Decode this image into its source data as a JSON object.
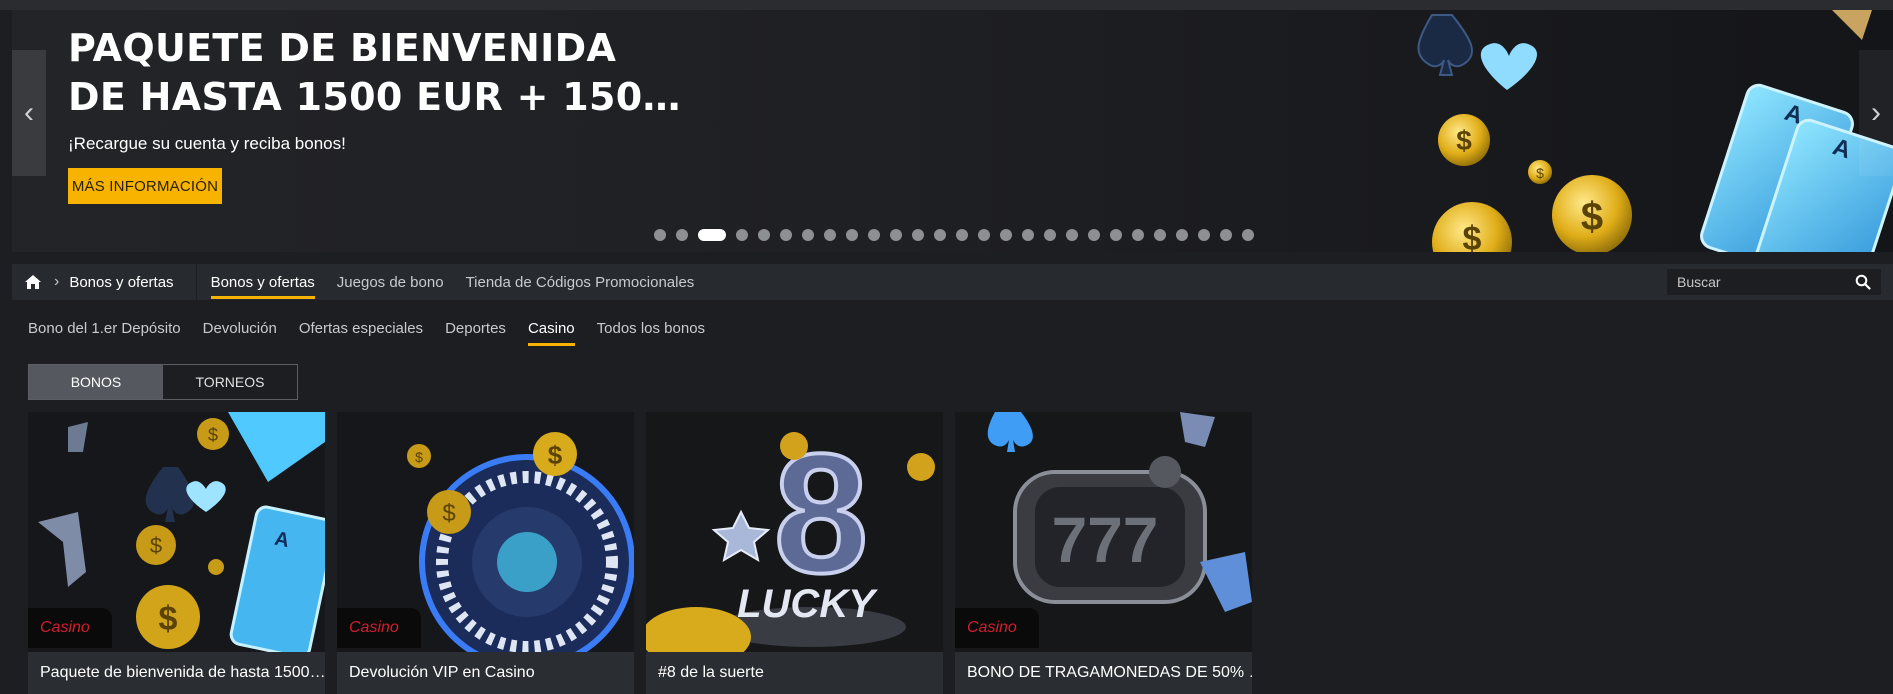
{
  "hero": {
    "title_line1": "PAQUETE DE BIENVENIDA",
    "title_line2": "DE HASTA 1500 EUR + 150…",
    "subtitle": "¡Recargue su cuenta y reciba bonos!",
    "button_label": "MÁS INFORMACIÓN",
    "prev_icon": "chevron-left-icon",
    "next_icon": "chevron-right-icon",
    "dots_count": 27,
    "active_dot_index": 2
  },
  "nav": {
    "home_icon": "home-icon",
    "breadcrumb_label": "Bonos y ofertas",
    "tabs": [
      {
        "label": "Bonos y ofertas"
      },
      {
        "label": "Juegos de bono"
      },
      {
        "label": "Tienda de Códigos Promocionales"
      }
    ],
    "search_placeholder": "Buscar",
    "search_icon": "search-icon"
  },
  "subtabs": [
    {
      "label": "Bono del 1.er Depósito"
    },
    {
      "label": "Devolución"
    },
    {
      "label": "Ofertas especiales"
    },
    {
      "label": "Deportes"
    },
    {
      "label": "Casino"
    },
    {
      "label": "Todos los bonos"
    }
  ],
  "active_subtab": "Casino",
  "toggle": {
    "bonos": "BONOS",
    "torneos": "TORNEOS"
  },
  "cards": [
    {
      "badge": "Casino",
      "title": "Paquete de bienvenida de hasta 1500…"
    },
    {
      "badge": "Casino",
      "title": "Devolución VIP en Casino"
    },
    {
      "badge": "",
      "title": "#8 de la suerte"
    },
    {
      "badge": "Casino",
      "title": "BONO DE TRAGAMONEDAS DE 50% …"
    }
  ],
  "colors": {
    "accent": "#f8b300",
    "badge_text": "#d21f2c",
    "background": "#1c1e22"
  }
}
